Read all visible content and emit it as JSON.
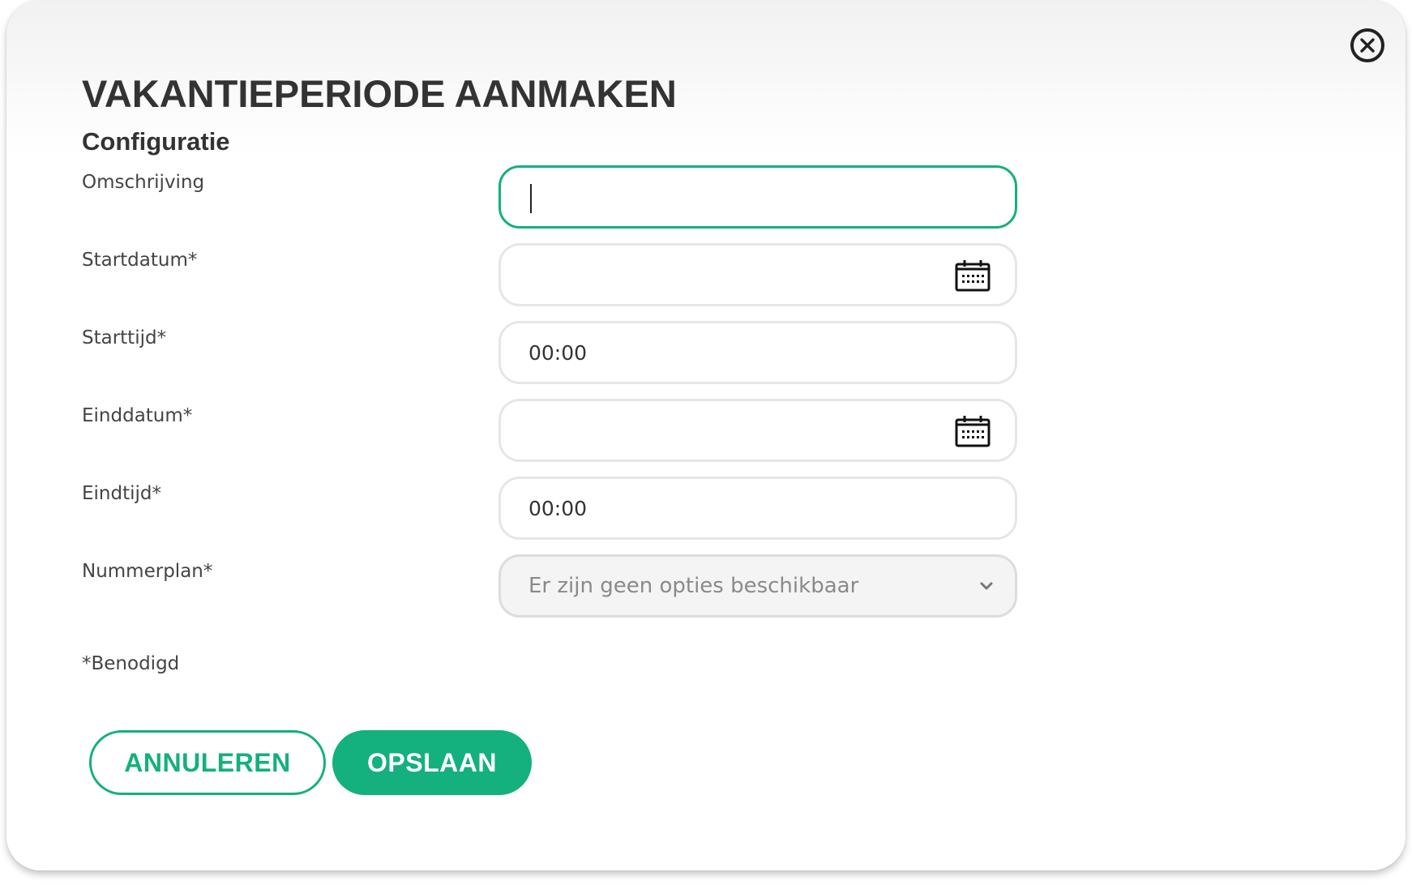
{
  "dialog": {
    "title": "VAKANTIEPERIODE AANMAKEN",
    "section": "Configuratie",
    "close_icon": "close-circle-icon",
    "accent_color": "#14b07d"
  },
  "form": {
    "omschrijving": {
      "label": "Omschrijving",
      "value": ""
    },
    "startdatum": {
      "label": "Startdatum*",
      "value": "",
      "icon": "calendar-icon"
    },
    "starttijd": {
      "label": "Starttijd*",
      "value": "00:00"
    },
    "einddatum": {
      "label": "Einddatum*",
      "value": "",
      "icon": "calendar-icon"
    },
    "eindtijd": {
      "label": "Eindtijd*",
      "value": "00:00"
    },
    "nummerplan": {
      "label": "Nummerplan*",
      "value": "Er zijn geen opties beschikbaar",
      "icon": "chevron-down-icon"
    }
  },
  "required_note": "*Benodigd",
  "actions": {
    "cancel_label": "ANNULEREN",
    "save_label": "OPSLAAN"
  }
}
